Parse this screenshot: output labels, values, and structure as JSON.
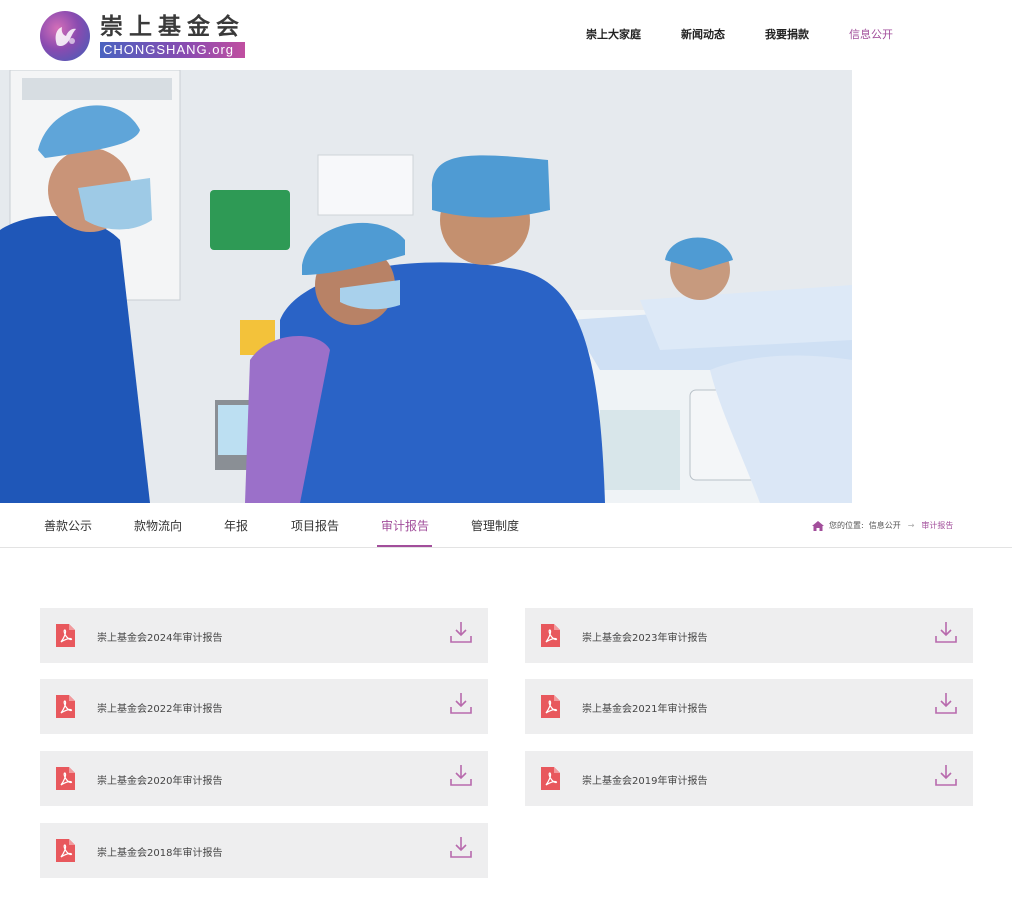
{
  "header": {
    "logo_cn": "崇上基金会",
    "logo_en": "CHONGSHANG.org",
    "nav": [
      {
        "label": "崇上大家庭"
      },
      {
        "label": "新闻动态"
      },
      {
        "label": "我要捐款"
      },
      {
        "label": "信息公开",
        "active": true
      }
    ]
  },
  "tabs": [
    {
      "label": "善款公示"
    },
    {
      "label": "款物流向"
    },
    {
      "label": "年报"
    },
    {
      "label": "项目报告"
    },
    {
      "label": "审计报告",
      "active": true
    },
    {
      "label": "管理制度"
    }
  ],
  "breadcrumb": {
    "prefix": "您的位置:",
    "parent": "信息公开",
    "current": "审计报告"
  },
  "reports": [
    {
      "title": "崇上基金会2024年审计报告"
    },
    {
      "title": "崇上基金会2023年审计报告"
    },
    {
      "title": "崇上基金会2022年审计报告"
    },
    {
      "title": "崇上基金会2021年审计报告"
    },
    {
      "title": "崇上基金会2020年审计报告"
    },
    {
      "title": "崇上基金会2019年审计报告"
    },
    {
      "title": "崇上基金会2018年审计报告"
    }
  ],
  "colors": {
    "accent": "#a24e9b",
    "pdf_icon": "#e8585d",
    "card_bg": "#eeeeef"
  },
  "icons": {
    "file": "pdf-icon",
    "download": "download-icon",
    "breadcrumb_home": "home-icon"
  }
}
